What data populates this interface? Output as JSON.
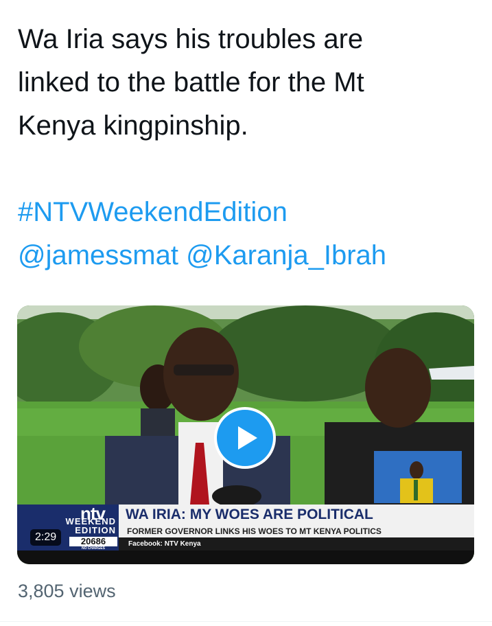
{
  "tweet": {
    "text_lines": [
      "Wa Iria says his troubles are",
      "linked to the battle for the Mt",
      "Kenya kingpinship."
    ],
    "hashtag": "#NTVWeekendEdition",
    "mentions": [
      "@jamessmat",
      "@Karanja_Ibrah"
    ]
  },
  "video": {
    "duration": "2:29",
    "overlay": {
      "headline": "WA IRIA: MY WOES ARE POLITICAL",
      "subheadline": "FORMER GOVERNOR LINKS HIS WOES TO MT KENYA POLITICS",
      "social": "Facebook: NTV Kenya",
      "logo": "ntv",
      "show_line1": "WEEKEND",
      "show_line2": "EDITION",
      "sms_number": "20686",
      "sms_note": "NO CHARGES"
    },
    "play_icon": "play-icon"
  },
  "stats": {
    "views": "3,805 views"
  },
  "colors": {
    "text": "#0f1419",
    "link": "#1d9bf0",
    "muted": "#536471",
    "ntv_blue": "#1a2d6b"
  }
}
